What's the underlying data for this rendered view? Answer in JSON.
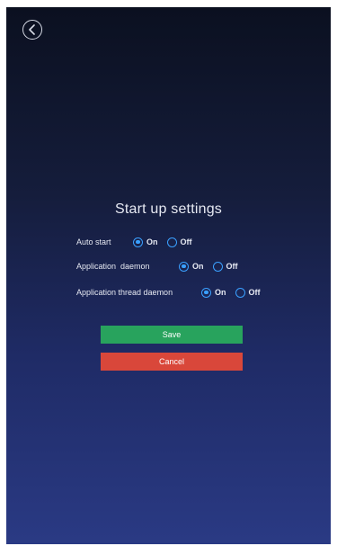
{
  "header": {
    "back_icon": "chevron-left-circle-icon"
  },
  "page": {
    "title": "Start up settings"
  },
  "settings": [
    {
      "label": "Auto start",
      "on_label": "On",
      "off_label": "Off",
      "value": "On"
    },
    {
      "label": "Application  daemon",
      "on_label": "On",
      "off_label": "Off",
      "value": "On"
    },
    {
      "label": "Application thread daemon",
      "on_label": "On",
      "off_label": "Off",
      "value": "On"
    }
  ],
  "actions": {
    "save_label": "Save",
    "cancel_label": "Cancel"
  },
  "colors": {
    "accent": "#3aa0ff",
    "save": "#28a35d",
    "cancel": "#d9473a"
  }
}
